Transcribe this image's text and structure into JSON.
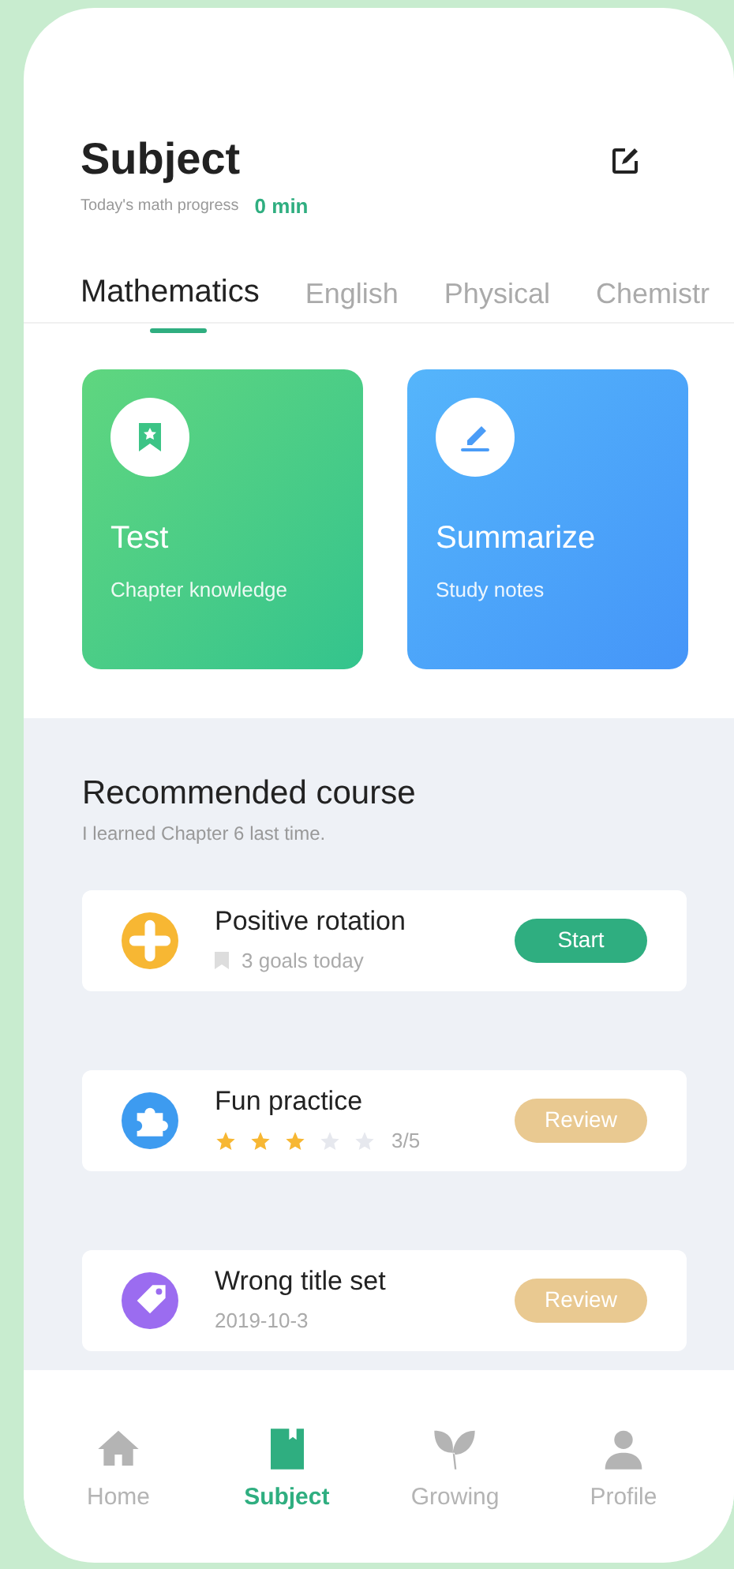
{
  "header": {
    "title": "Subject",
    "progress_label": "Today's math progress",
    "progress_value": "0 min"
  },
  "tabs": [
    {
      "label": "Mathematics",
      "selected": true
    },
    {
      "label": "English",
      "selected": false
    },
    {
      "label": "Physical",
      "selected": false
    },
    {
      "label": "Chemistr",
      "selected": false
    }
  ],
  "feature_cards": [
    {
      "kind": "test",
      "title": "Test",
      "subtitle": "Chapter knowledge"
    },
    {
      "kind": "summarize",
      "title": "Summarize",
      "subtitle": "Study notes"
    }
  ],
  "recommended": {
    "title": "Recommended course",
    "subtitle": "I learned Chapter 6 last time."
  },
  "courses": [
    {
      "kind": "goals",
      "color": "#f7b733",
      "title": "Positive rotation",
      "detail": "3 goals today",
      "button": "Start",
      "active": true
    },
    {
      "kind": "stars",
      "color": "#3d9bf0",
      "title": "Fun practice",
      "stars": 3,
      "detail": "3/5",
      "button": "Review",
      "active": false
    },
    {
      "kind": "date",
      "color": "#9b6cf0",
      "title": "Wrong title set",
      "detail": "2019-10-3",
      "button": "Review",
      "active": false
    }
  ],
  "nav": [
    {
      "label": "Home",
      "selected": false
    },
    {
      "label": "Subject",
      "selected": true
    },
    {
      "label": "Growing",
      "selected": false
    },
    {
      "label": "Profile",
      "selected": false
    }
  ]
}
